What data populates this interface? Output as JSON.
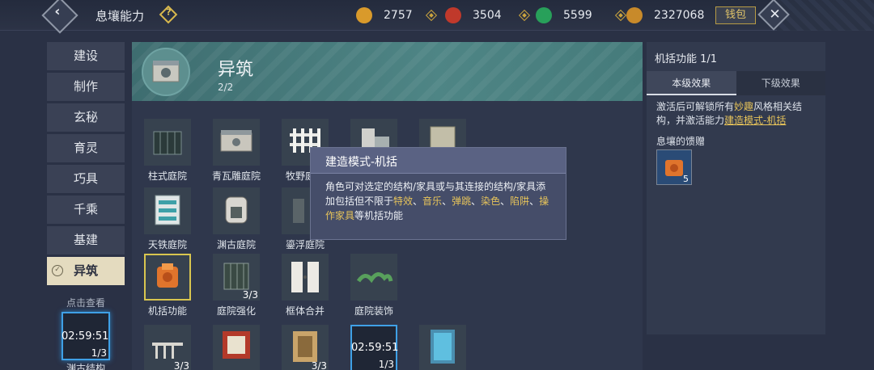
{
  "header": {
    "title": "息壤能力",
    "back_glyph": "‹",
    "help_glyph": "?",
    "close_glyph": "✕",
    "wallet_label": "钱包",
    "resources": [
      {
        "icon": "gold-coin-icon",
        "value": "2757",
        "color": "#d99a2b"
      },
      {
        "icon": "red-orb-icon",
        "value": "3504",
        "color": "#c0392b"
      },
      {
        "icon": "jade-dragon-icon",
        "value": "5599",
        "color": "#28a05a"
      },
      {
        "icon": "gold-ingot-icon",
        "value": "2327068",
        "color": "#c88a2a"
      }
    ]
  },
  "sidebar": {
    "items": [
      {
        "label": "建设",
        "active": false
      },
      {
        "label": "制作",
        "active": false
      },
      {
        "label": "玄秘",
        "active": false
      },
      {
        "label": "育灵",
        "active": false
      },
      {
        "label": "巧具",
        "active": false
      },
      {
        "label": "千乘",
        "active": false
      },
      {
        "label": "基建",
        "active": false
      },
      {
        "label": "异筑",
        "active": true
      }
    ],
    "footer": {
      "hint": "点击查看",
      "timer": "02:59:51",
      "count": "1/3",
      "name": "渊古结构"
    }
  },
  "main": {
    "banner": {
      "title": "异筑",
      "progress": "2/2"
    },
    "items": [
      {
        "label": "柱式庭院",
        "badge": ""
      },
      {
        "label": "青瓦雕庭院",
        "badge": ""
      },
      {
        "label": "牧野庭院",
        "badge": ""
      },
      {
        "label": "",
        "badge": ""
      },
      {
        "label": "",
        "badge": ""
      },
      {
        "label": "天铁庭院",
        "badge": ""
      },
      {
        "label": "渊古庭院",
        "badge": ""
      },
      {
        "label": "鎏浮庭院",
        "badge": ""
      },
      {
        "label": "机括功能",
        "badge": ""
      },
      {
        "label": "庭院强化",
        "badge": "3/3"
      },
      {
        "label": "框体合并",
        "badge": ""
      },
      {
        "label": "庭院装饰",
        "badge": ""
      },
      {
        "label": "",
        "badge": "3/3"
      },
      {
        "label": "",
        "badge": ""
      },
      {
        "label": "",
        "badge": "3/3"
      },
      {
        "label": "",
        "badge": "02:59:51",
        "badge2": "1/3"
      },
      {
        "label": "",
        "badge": ""
      }
    ]
  },
  "right_panel": {
    "title": "机括功能 1/1",
    "tabs": [
      "本级效果",
      "下级效果"
    ],
    "desc_1": "激活后可解锁所有",
    "desc_hl": "妙趣",
    "desc_2": "风格相关结构，并激活能力",
    "desc_link": "建造模式-机括",
    "gift_label": "息壤的馈赠",
    "gift_count": "5"
  },
  "tooltip": {
    "title": "建造模式-机括",
    "text_1": "角色可对选定的结构/家具或与其连接的结构/家具添加包括但不限于",
    "hl_1": "特效",
    "sep_1": "、",
    "hl_2": "音乐",
    "sep_2": "、",
    "hl_3": "弹跳",
    "sep_3": "、",
    "hl_4": "染色",
    "sep_4": "、",
    "hl_5": "陷阱",
    "sep_5": "、",
    "hl_6": "操作家具",
    "text_2": "等机括功能"
  }
}
